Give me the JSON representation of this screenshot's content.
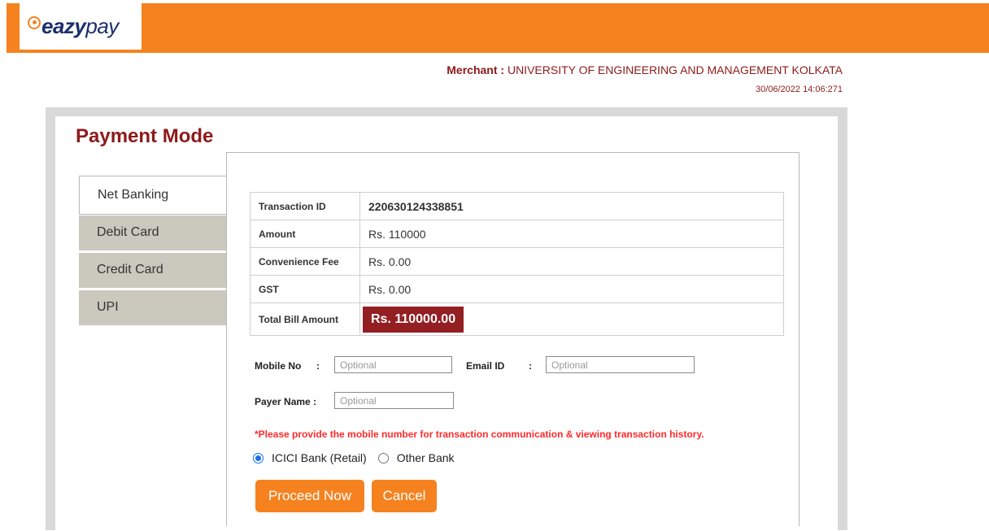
{
  "brand": {
    "logo_text_bold": "eazy",
    "logo_text_light": "pay",
    "brand_color": "#f5821f"
  },
  "header": {
    "merchant_label": "Merchant :",
    "merchant_name": "UNIVERSITY OF ENGINEERING AND MANAGEMENT KOLKATA",
    "datetime": "30/06/2022 14:06:271"
  },
  "page": {
    "title": "Payment Mode"
  },
  "tabs": [
    {
      "label": "Net Banking",
      "active": true
    },
    {
      "label": "Debit Card",
      "active": false
    },
    {
      "label": "Credit Card",
      "active": false
    },
    {
      "label": "UPI",
      "active": false
    }
  ],
  "transaction": {
    "rows": [
      {
        "label": "Transaction ID",
        "value": "220630124338851"
      },
      {
        "label": "Amount",
        "value": "Rs. 110000"
      },
      {
        "label": "Convenience Fee",
        "value": "Rs. 0.00"
      },
      {
        "label": "GST",
        "value": "Rs. 0.00"
      },
      {
        "label": "Total Bill Amount",
        "value": "Rs. 110000.00"
      }
    ]
  },
  "form": {
    "mobile_label": "Mobile No",
    "email_label": "Email ID",
    "colon": ":",
    "payer_label": "Payer Name :",
    "mobile_placeholder": "Optional",
    "email_placeholder": "Optional",
    "payer_placeholder": "Optional",
    "note": "*Please provide the mobile number for transaction communication & viewing transaction history."
  },
  "bank_options": [
    {
      "label": "ICICI Bank (Retail)",
      "selected": true
    },
    {
      "label": "Other Bank",
      "selected": false
    }
  ],
  "buttons": {
    "proceed": "Proceed Now",
    "cancel": "Cancel"
  },
  "colors": {
    "accent_dark_red": "#8e1a1a",
    "total_badge_bg": "#941f23",
    "note_red": "#ff2a2a",
    "tab_inactive_bg": "#cbc8be"
  }
}
